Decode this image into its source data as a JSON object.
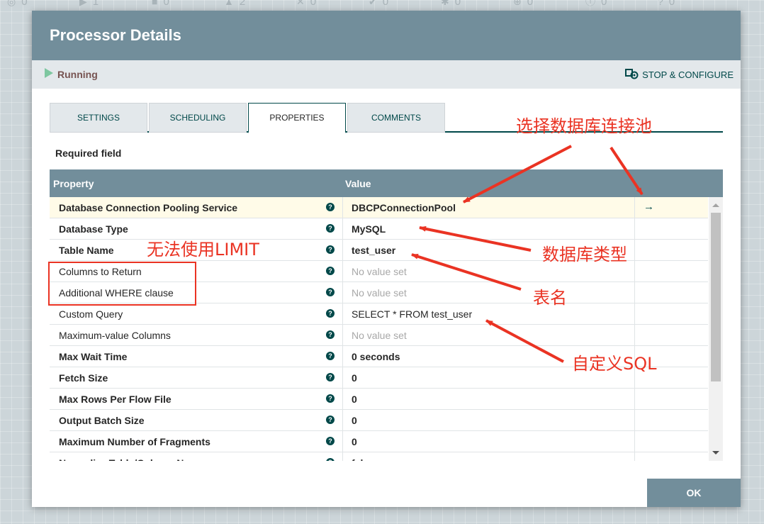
{
  "status_strip": {
    "items": [
      {
        "icon": "target-icon",
        "value": "0"
      },
      {
        "icon": "play-icon",
        "value": "1"
      },
      {
        "icon": "stop-icon",
        "value": "0"
      },
      {
        "icon": "warning-icon",
        "value": "2"
      },
      {
        "icon": "disabled-icon",
        "value": "0"
      },
      {
        "icon": "check-icon",
        "value": "0"
      },
      {
        "icon": "asterisk-icon",
        "value": "0"
      },
      {
        "icon": "upload-icon",
        "value": "0"
      },
      {
        "icon": "info-icon",
        "value": "0"
      },
      {
        "icon": "question-icon",
        "value": "0"
      }
    ]
  },
  "dialog": {
    "title": "Processor Details",
    "run_state": "Running",
    "stop_configure_label": "STOP & CONFIGURE"
  },
  "tabs": [
    {
      "label": "SETTINGS",
      "active": false
    },
    {
      "label": "SCHEDULING",
      "active": false
    },
    {
      "label": "PROPERTIES",
      "active": true
    },
    {
      "label": "COMMENTS",
      "active": false
    }
  ],
  "required_field_label": "Required field",
  "table": {
    "header_property": "Property",
    "header_value": "Value",
    "rows": [
      {
        "property": "Database Connection Pooling Service",
        "value": "DBCPConnectionPool",
        "required": true,
        "value_set": true,
        "selected": true,
        "action": "→"
      },
      {
        "property": "Database Type",
        "value": "MySQL",
        "required": true,
        "value_set": true
      },
      {
        "property": "Table Name",
        "value": "test_user",
        "required": true,
        "value_set": true
      },
      {
        "property": "Columns to Return",
        "value": "No value set",
        "required": false,
        "value_set": false
      },
      {
        "property": "Additional WHERE clause",
        "value": "No value set",
        "required": false,
        "value_set": false
      },
      {
        "property": "Custom Query",
        "value": "SELECT * FROM test_user",
        "required": false,
        "value_set": true
      },
      {
        "property": "Maximum-value Columns",
        "value": "No value set",
        "required": false,
        "value_set": false
      },
      {
        "property": "Max Wait Time",
        "value": "0 seconds",
        "required": true,
        "value_set": true
      },
      {
        "property": "Fetch Size",
        "value": "0",
        "required": true,
        "value_set": true
      },
      {
        "property": "Max Rows Per Flow File",
        "value": "0",
        "required": true,
        "value_set": true
      },
      {
        "property": "Output Batch Size",
        "value": "0",
        "required": true,
        "value_set": true
      },
      {
        "property": "Maximum Number of Fragments",
        "value": "0",
        "required": true,
        "value_set": true
      },
      {
        "property": "Normalize Table/Column Names",
        "value": "false",
        "required": true,
        "value_set": true
      }
    ]
  },
  "ok_label": "OK",
  "annotations": {
    "select_pool": "选择数据库连接池",
    "db_type": "数据库类型",
    "table_name": "表名",
    "custom_sql": "自定义SQL",
    "no_limit": "无法使用LIMIT"
  },
  "colors": {
    "header_bg": "#728e9b",
    "accent": "#004849",
    "annotation_red": "#ea3323",
    "running_green": "#7dc7a0"
  }
}
